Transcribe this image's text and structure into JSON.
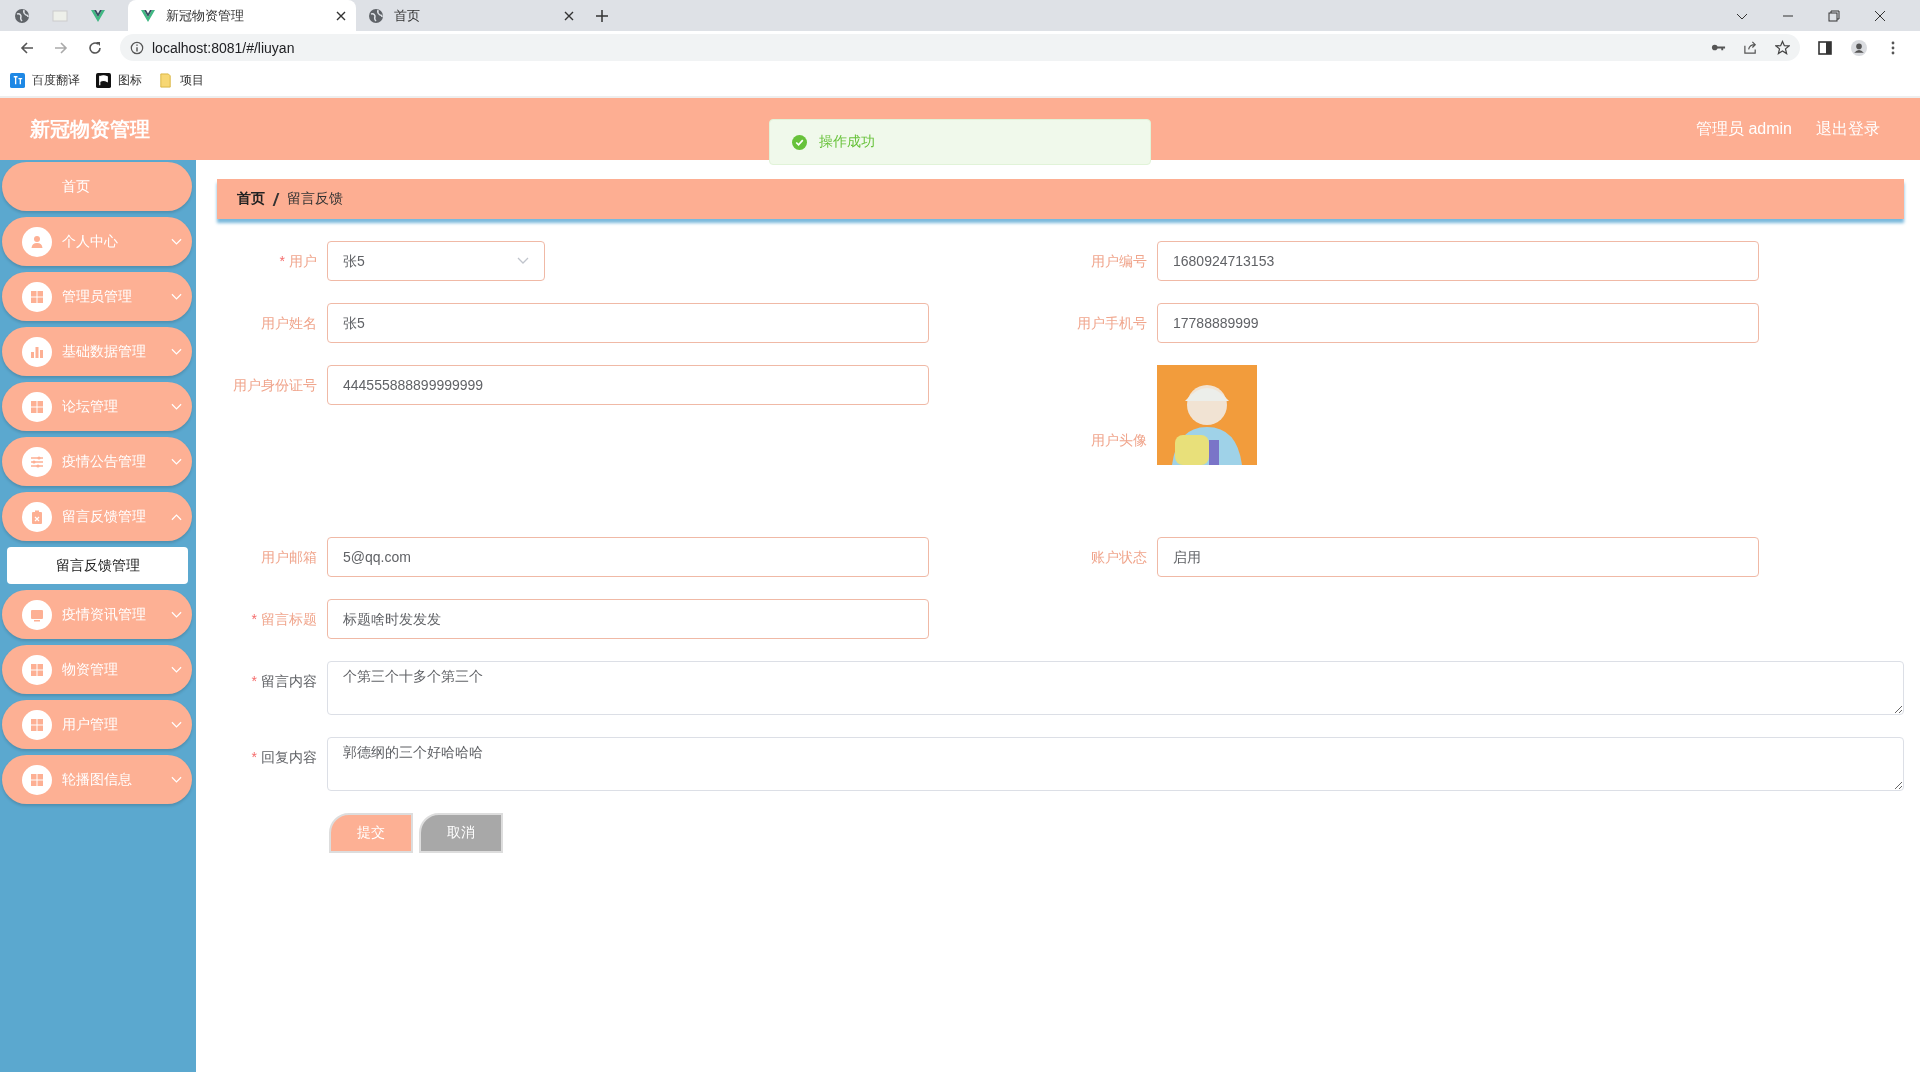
{
  "browser": {
    "tabs": [
      {
        "title": "新冠物资管理",
        "selected": true
      },
      {
        "title": "首页",
        "selected": false
      }
    ],
    "url": "localhost:8081/#/liuyan",
    "bookmarks": [
      {
        "label": "百度翻译",
        "kind": "translate"
      },
      {
        "label": "图标",
        "kind": "flag"
      },
      {
        "label": "项目",
        "kind": "folder"
      }
    ]
  },
  "header": {
    "title": "新冠物资管理",
    "toast": "操作成功",
    "user": "管理员 admin",
    "logout": "退出登录"
  },
  "sidebar": {
    "items": [
      {
        "label": "首页",
        "kind": "plain"
      },
      {
        "label": "个人中心",
        "kind": "user",
        "expanded": false
      },
      {
        "label": "管理员管理",
        "kind": "grid",
        "expanded": false
      },
      {
        "label": "基础数据管理",
        "kind": "chart",
        "expanded": false
      },
      {
        "label": "论坛管理",
        "kind": "grid",
        "expanded": false
      },
      {
        "label": "疫情公告管理",
        "kind": "sliders",
        "expanded": false
      },
      {
        "label": "留言反馈管理",
        "kind": "clipboard",
        "expanded": true,
        "children": [
          {
            "label": "留言反馈管理"
          }
        ]
      },
      {
        "label": "疫情资讯管理",
        "kind": "monitor",
        "expanded": false
      },
      {
        "label": "物资管理",
        "kind": "grid",
        "expanded": false
      },
      {
        "label": "用户管理",
        "kind": "grid",
        "expanded": false
      },
      {
        "label": "轮播图信息",
        "kind": "grid",
        "expanded": false
      }
    ]
  },
  "breadcrumb": [
    "首页",
    "留言反馈"
  ],
  "form": {
    "grid": [
      {
        "label": "用户",
        "required_mark": "*",
        "kind": "select",
        "value": "张5"
      },
      {
        "label": "用户编号",
        "kind": "input",
        "value": "1680924713153"
      },
      {
        "label": "用户姓名",
        "kind": "input",
        "value": "张5"
      },
      {
        "label": "用户手机号",
        "kind": "input",
        "value": "17788889999"
      },
      {
        "label": "用户身份证号",
        "kind": "input",
        "value": "444555888899999999"
      },
      {
        "label": "用户头像"
      },
      {
        "label": "用户邮箱",
        "kind": "input",
        "value": "5@qq.com"
      },
      {
        "label": "账户状态",
        "kind": "input",
        "value": "启用"
      }
    ],
    "wide": [
      {
        "label": "留言标题",
        "required_mark": "*",
        "kind": "input",
        "value": "标题啥时发发发"
      },
      {
        "label": "留言内容",
        "required_mark": "*",
        "kind": "textarea",
        "value": "个第三个十多个第三个"
      },
      {
        "label": "回复内容",
        "required_mark": "*",
        "kind": "textarea",
        "value": "郭德纲的三个好哈哈哈"
      }
    ],
    "buttons": [
      {
        "label": "提交",
        "kind": "primary"
      },
      {
        "label": "取消",
        "kind": "secondary"
      }
    ]
  }
}
